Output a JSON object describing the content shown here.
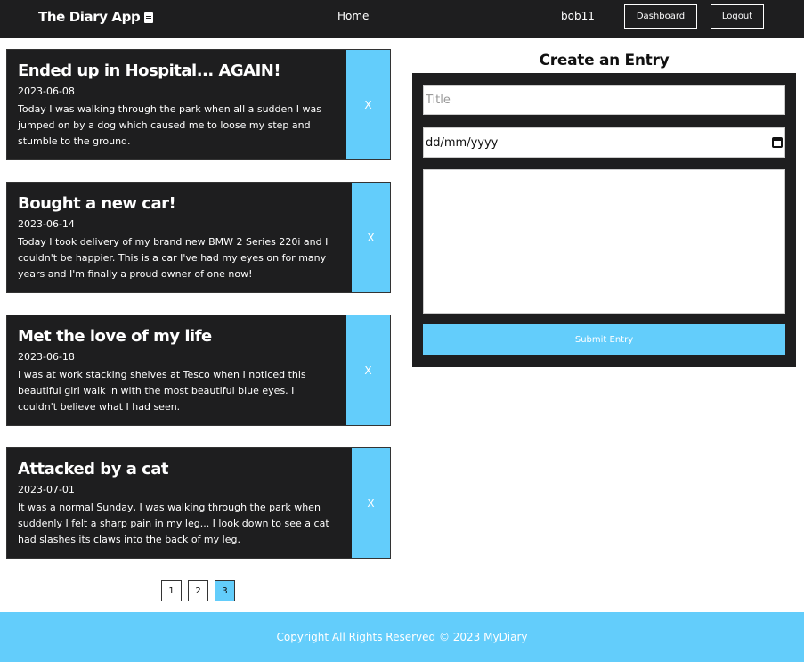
{
  "nav": {
    "brand": "The Diary App",
    "brand_icon": "book-icon",
    "home": "Home",
    "username": "bob11",
    "dashboard": "Dashboard",
    "logout": "Logout"
  },
  "entries": [
    {
      "title": "Ended up in Hospital... AGAIN!",
      "date": "2023-06-08",
      "body": "Today I was walking through the park when all a sudden I was jumped on by a dog which caused me to loose my step and stumble to the ground.",
      "delete": "X"
    },
    {
      "title": "Bought a new car!",
      "date": "2023-06-14",
      "body": "Today I took delivery of my brand new BMW 2 Series 220i and I couldn't be happier. This is a car I've had my eyes on for many years and I'm finally a proud owner of one now!",
      "delete": "X"
    },
    {
      "title": "Met the love of my life",
      "date": "2023-06-18",
      "body": "I was at work stacking shelves at Tesco when I noticed this beautiful girl walk in with the most beautiful blue eyes. I couldn't believe what I had seen.",
      "delete": "X"
    },
    {
      "title": "Attacked by a cat",
      "date": "2023-07-01",
      "body": "It was a normal Sunday, I was walking through the park when suddenly I felt a sharp pain in my leg... I look down to see a cat had slashes its claws into the back of my leg.",
      "delete": "X"
    }
  ],
  "pagination": {
    "pages": [
      "1",
      "2",
      "3"
    ],
    "current": "3"
  },
  "form": {
    "heading": "Create an Entry",
    "title_placeholder": "Title",
    "date_placeholder": "dd/mm/yyyy",
    "body_value": "",
    "submit": "Submit Entry"
  },
  "footer": {
    "text": "Copyright All Rights Reserved © 2023 MyDiary"
  },
  "colors": {
    "dark": "#1e1e1f",
    "accent": "#63cdfb"
  }
}
